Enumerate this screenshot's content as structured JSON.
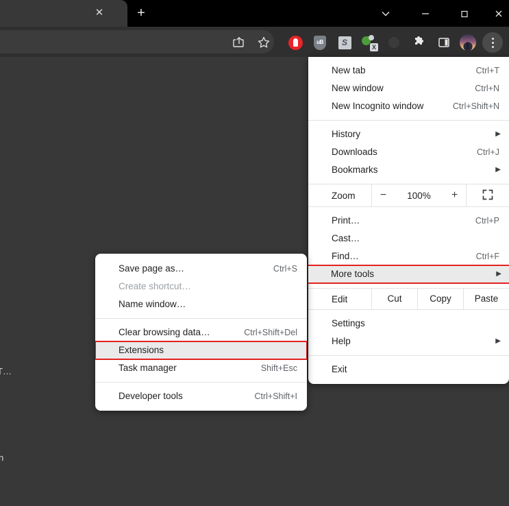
{
  "window": {
    "tab_title": "",
    "controls": {
      "tab_search": "chevron-down",
      "minimize": "–",
      "maximize": "□",
      "close": "✕"
    },
    "new_tab_label": "+",
    "tab_close_label": "✕"
  },
  "toolbar": {
    "icons": [
      {
        "name": "share-icon",
        "label": "Share"
      },
      {
        "name": "bookmark-star-icon",
        "label": "Bookmark this tab"
      },
      {
        "name": "adblock-extension-icon",
        "label": "AdBlock"
      },
      {
        "name": "ublock-origin-extension-icon",
        "label": "uB"
      },
      {
        "name": "s-extension-icon",
        "label": "S"
      },
      {
        "name": "green-x-extension-icon",
        "label": "X"
      },
      {
        "name": "faded-extension-icon",
        "label": ""
      },
      {
        "name": "extensions-puzzle-icon",
        "label": "Extensions"
      },
      {
        "name": "side-panel-icon",
        "label": "Side panel"
      },
      {
        "name": "profile-avatar",
        "label": "Profile"
      },
      {
        "name": "chrome-menu-kebab-icon",
        "label": "Customize and control Google Chrome"
      }
    ]
  },
  "page_fragments": {
    "fragment_1": "T…",
    "fragment_2": "n"
  },
  "main_menu": {
    "groups": [
      {
        "items": [
          {
            "label": "New tab",
            "shortcut": "Ctrl+T",
            "arrow": false,
            "disabled": false,
            "highlighted": false
          },
          {
            "label": "New window",
            "shortcut": "Ctrl+N",
            "arrow": false,
            "disabled": false,
            "highlighted": false
          },
          {
            "label": "New Incognito window",
            "shortcut": "Ctrl+Shift+N",
            "arrow": false,
            "disabled": false,
            "highlighted": false
          }
        ]
      },
      {
        "items": [
          {
            "label": "History",
            "shortcut": "",
            "arrow": true,
            "disabled": false,
            "highlighted": false
          },
          {
            "label": "Downloads",
            "shortcut": "Ctrl+J",
            "arrow": false,
            "disabled": false,
            "highlighted": false
          },
          {
            "label": "Bookmarks",
            "shortcut": "",
            "arrow": true,
            "disabled": false,
            "highlighted": false
          }
        ]
      }
    ],
    "zoom_row": {
      "label": "Zoom",
      "minus": "−",
      "level": "100%",
      "plus": "+",
      "fullscreen_icon": "fullscreen-icon"
    },
    "group_after_zoom": {
      "items": [
        {
          "label": "Print…",
          "shortcut": "Ctrl+P",
          "arrow": false,
          "disabled": false,
          "highlighted": false
        },
        {
          "label": "Cast…",
          "shortcut": "",
          "arrow": false,
          "disabled": false,
          "highlighted": false
        },
        {
          "label": "Find…",
          "shortcut": "Ctrl+F",
          "arrow": false,
          "disabled": false,
          "highlighted": false
        },
        {
          "label": "More tools",
          "shortcut": "",
          "arrow": true,
          "disabled": false,
          "highlighted": true
        }
      ]
    },
    "edit_row": {
      "label": "Edit",
      "actions": [
        "Cut",
        "Copy",
        "Paste"
      ]
    },
    "group_tail": {
      "items": [
        {
          "label": "Settings",
          "shortcut": "",
          "arrow": false,
          "disabled": false,
          "highlighted": false
        },
        {
          "label": "Help",
          "shortcut": "",
          "arrow": true,
          "disabled": false,
          "highlighted": false
        }
      ]
    },
    "group_exit": {
      "items": [
        {
          "label": "Exit",
          "shortcut": "",
          "arrow": false,
          "disabled": false,
          "highlighted": false
        }
      ]
    }
  },
  "submenu_more_tools": {
    "groups": [
      {
        "items": [
          {
            "label": "Save page as…",
            "shortcut": "Ctrl+S",
            "disabled": false,
            "highlighted": false
          },
          {
            "label": "Create shortcut…",
            "shortcut": "",
            "disabled": true,
            "highlighted": false
          },
          {
            "label": "Name window…",
            "shortcut": "",
            "disabled": false,
            "highlighted": false
          }
        ]
      },
      {
        "items": [
          {
            "label": "Clear browsing data…",
            "shortcut": "Ctrl+Shift+Del",
            "disabled": false,
            "highlighted": false
          },
          {
            "label": "Extensions",
            "shortcut": "",
            "disabled": false,
            "highlighted": true
          },
          {
            "label": "Task manager",
            "shortcut": "Shift+Esc",
            "disabled": false,
            "highlighted": false
          }
        ]
      },
      {
        "items": [
          {
            "label": "Developer tools",
            "shortcut": "Ctrl+Shift+I",
            "disabled": false,
            "highlighted": false
          }
        ]
      }
    ]
  },
  "colors": {
    "highlight_border": "#e2221f",
    "highlight_fill": "#eaeaea",
    "menu_bg": "#ffffff",
    "page_bg": "#383838",
    "tabstrip_bg": "#000000",
    "toolbar_bg": "#2f2f2f"
  }
}
